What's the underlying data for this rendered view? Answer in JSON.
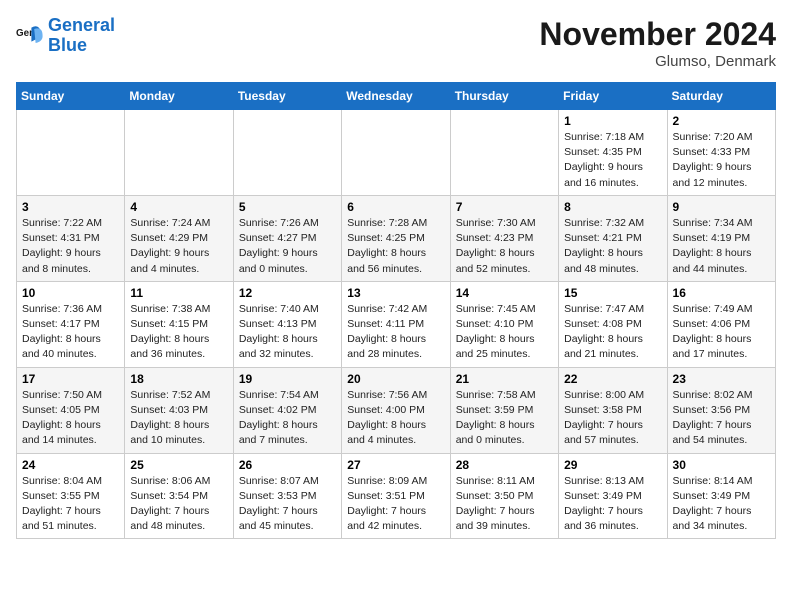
{
  "header": {
    "logo_general": "General",
    "logo_blue": "Blue",
    "month_title": "November 2024",
    "location": "Glumso, Denmark"
  },
  "days_of_week": [
    "Sunday",
    "Monday",
    "Tuesday",
    "Wednesday",
    "Thursday",
    "Friday",
    "Saturday"
  ],
  "weeks": [
    [
      {
        "day": "",
        "info": ""
      },
      {
        "day": "",
        "info": ""
      },
      {
        "day": "",
        "info": ""
      },
      {
        "day": "",
        "info": ""
      },
      {
        "day": "",
        "info": ""
      },
      {
        "day": "1",
        "info": "Sunrise: 7:18 AM\nSunset: 4:35 PM\nDaylight: 9 hours and 16 minutes."
      },
      {
        "day": "2",
        "info": "Sunrise: 7:20 AM\nSunset: 4:33 PM\nDaylight: 9 hours and 12 minutes."
      }
    ],
    [
      {
        "day": "3",
        "info": "Sunrise: 7:22 AM\nSunset: 4:31 PM\nDaylight: 9 hours and 8 minutes."
      },
      {
        "day": "4",
        "info": "Sunrise: 7:24 AM\nSunset: 4:29 PM\nDaylight: 9 hours and 4 minutes."
      },
      {
        "day": "5",
        "info": "Sunrise: 7:26 AM\nSunset: 4:27 PM\nDaylight: 9 hours and 0 minutes."
      },
      {
        "day": "6",
        "info": "Sunrise: 7:28 AM\nSunset: 4:25 PM\nDaylight: 8 hours and 56 minutes."
      },
      {
        "day": "7",
        "info": "Sunrise: 7:30 AM\nSunset: 4:23 PM\nDaylight: 8 hours and 52 minutes."
      },
      {
        "day": "8",
        "info": "Sunrise: 7:32 AM\nSunset: 4:21 PM\nDaylight: 8 hours and 48 minutes."
      },
      {
        "day": "9",
        "info": "Sunrise: 7:34 AM\nSunset: 4:19 PM\nDaylight: 8 hours and 44 minutes."
      }
    ],
    [
      {
        "day": "10",
        "info": "Sunrise: 7:36 AM\nSunset: 4:17 PM\nDaylight: 8 hours and 40 minutes."
      },
      {
        "day": "11",
        "info": "Sunrise: 7:38 AM\nSunset: 4:15 PM\nDaylight: 8 hours and 36 minutes."
      },
      {
        "day": "12",
        "info": "Sunrise: 7:40 AM\nSunset: 4:13 PM\nDaylight: 8 hours and 32 minutes."
      },
      {
        "day": "13",
        "info": "Sunrise: 7:42 AM\nSunset: 4:11 PM\nDaylight: 8 hours and 28 minutes."
      },
      {
        "day": "14",
        "info": "Sunrise: 7:45 AM\nSunset: 4:10 PM\nDaylight: 8 hours and 25 minutes."
      },
      {
        "day": "15",
        "info": "Sunrise: 7:47 AM\nSunset: 4:08 PM\nDaylight: 8 hours and 21 minutes."
      },
      {
        "day": "16",
        "info": "Sunrise: 7:49 AM\nSunset: 4:06 PM\nDaylight: 8 hours and 17 minutes."
      }
    ],
    [
      {
        "day": "17",
        "info": "Sunrise: 7:50 AM\nSunset: 4:05 PM\nDaylight: 8 hours and 14 minutes."
      },
      {
        "day": "18",
        "info": "Sunrise: 7:52 AM\nSunset: 4:03 PM\nDaylight: 8 hours and 10 minutes."
      },
      {
        "day": "19",
        "info": "Sunrise: 7:54 AM\nSunset: 4:02 PM\nDaylight: 8 hours and 7 minutes."
      },
      {
        "day": "20",
        "info": "Sunrise: 7:56 AM\nSunset: 4:00 PM\nDaylight: 8 hours and 4 minutes."
      },
      {
        "day": "21",
        "info": "Sunrise: 7:58 AM\nSunset: 3:59 PM\nDaylight: 8 hours and 0 minutes."
      },
      {
        "day": "22",
        "info": "Sunrise: 8:00 AM\nSunset: 3:58 PM\nDaylight: 7 hours and 57 minutes."
      },
      {
        "day": "23",
        "info": "Sunrise: 8:02 AM\nSunset: 3:56 PM\nDaylight: 7 hours and 54 minutes."
      }
    ],
    [
      {
        "day": "24",
        "info": "Sunrise: 8:04 AM\nSunset: 3:55 PM\nDaylight: 7 hours and 51 minutes."
      },
      {
        "day": "25",
        "info": "Sunrise: 8:06 AM\nSunset: 3:54 PM\nDaylight: 7 hours and 48 minutes."
      },
      {
        "day": "26",
        "info": "Sunrise: 8:07 AM\nSunset: 3:53 PM\nDaylight: 7 hours and 45 minutes."
      },
      {
        "day": "27",
        "info": "Sunrise: 8:09 AM\nSunset: 3:51 PM\nDaylight: 7 hours and 42 minutes."
      },
      {
        "day": "28",
        "info": "Sunrise: 8:11 AM\nSunset: 3:50 PM\nDaylight: 7 hours and 39 minutes."
      },
      {
        "day": "29",
        "info": "Sunrise: 8:13 AM\nSunset: 3:49 PM\nDaylight: 7 hours and 36 minutes."
      },
      {
        "day": "30",
        "info": "Sunrise: 8:14 AM\nSunset: 3:49 PM\nDaylight: 7 hours and 34 minutes."
      }
    ]
  ]
}
